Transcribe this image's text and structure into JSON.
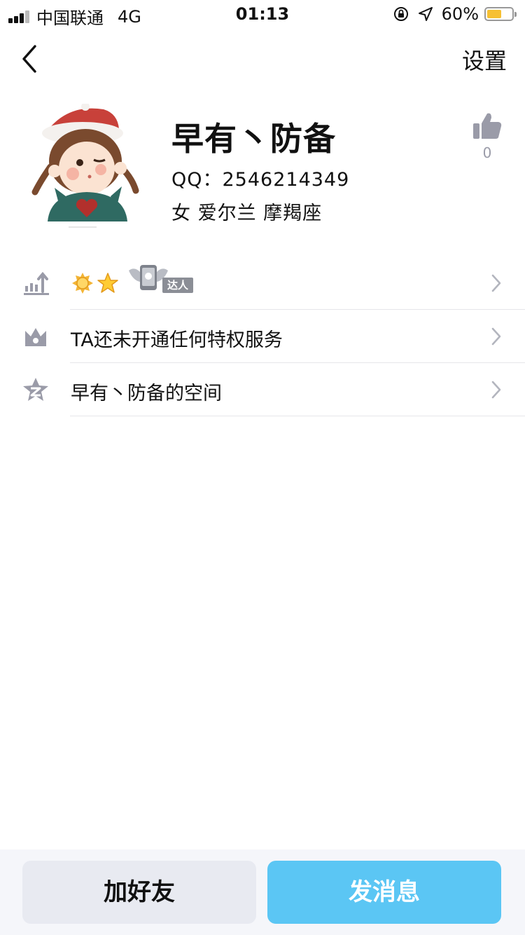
{
  "status_bar": {
    "carrier": "中国联通",
    "network": "4G",
    "time": "01:13",
    "battery": "60%",
    "battery_level": 0.6,
    "battery_color": "#f6c033"
  },
  "nav": {
    "back_icon": "chevron-left-icon",
    "settings_label": "设置"
  },
  "profile": {
    "nickname": "早有丶防备",
    "qq": "QQ：2546214349",
    "info": "女  爱尔兰  摩羯座",
    "like_count": "0"
  },
  "rows": [
    {
      "icon": "level-up-icon",
      "label": "",
      "badges": [
        "sun-badge",
        "star-badge",
        "daren-badge"
      ],
      "daren_label": "达人"
    },
    {
      "icon": "crown-icon",
      "label": "TA还未开通任何特权服务"
    },
    {
      "icon": "qzone-star-icon",
      "label": "早有丶防备的空间"
    }
  ],
  "bottom": {
    "add_friend": "加好友",
    "send_message": "发消息"
  },
  "colors": {
    "accent": "#5bc6f4",
    "secondary_button": "#e8eaf1",
    "icon_gray": "#9a9ba8"
  }
}
